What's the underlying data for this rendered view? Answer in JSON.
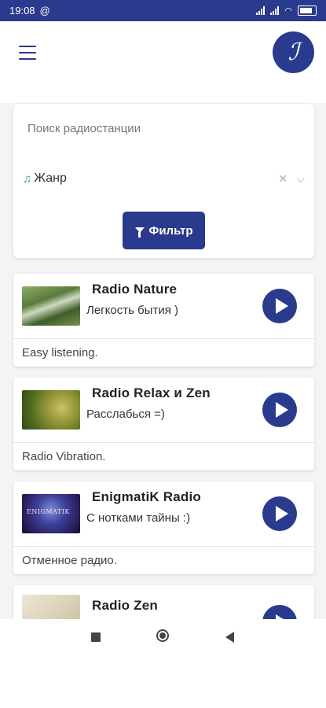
{
  "status_bar": {
    "time": "19:08",
    "notification_icon": "at-sign-icon",
    "signal_icons": [
      "signal-icon",
      "signal-icon",
      "wifi-icon",
      "battery-icon"
    ]
  },
  "header": {
    "menu_icon": "hamburger-icon",
    "logo_glyph": "ℐ"
  },
  "search": {
    "placeholder": "Поиск радиостанции",
    "value": ""
  },
  "genre": {
    "icon": "music-note-icon",
    "label": "Жанр",
    "clear_symbol": "×",
    "chevron_symbol": "⌄"
  },
  "filter_button": {
    "icon": "funnel-icon",
    "label": "Фильтр"
  },
  "stations": [
    {
      "name": "Radio Nature",
      "slogan": "Легкость бытия )",
      "genre": "Easy listening."
    },
    {
      "name": "Radio Relax и Zen",
      "slogan": "Расслабься =)",
      "genre": "Radio Vibration."
    },
    {
      "name": "EnigmatiK Radio",
      "slogan": "С нотками тайны :)",
      "genre": "Отменное радио.",
      "thumb_text": "ENIGMATIK"
    },
    {
      "name": "Radio Zen",
      "slogan": "",
      "genre": ""
    }
  ],
  "colors": {
    "primary": "#2a3a8c",
    "background": "#f4f4f6",
    "genre_icon": "#2fae8f"
  }
}
